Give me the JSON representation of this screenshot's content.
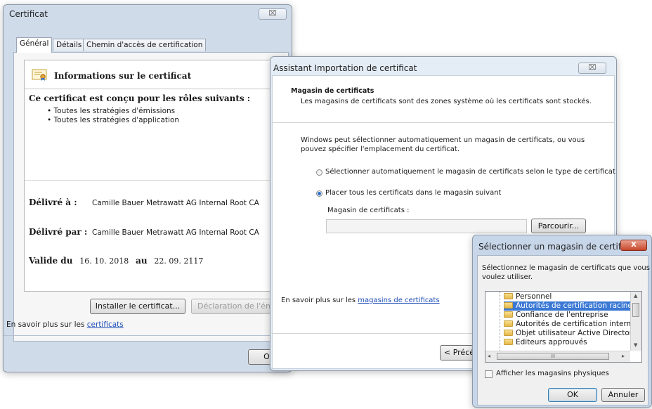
{
  "cert_window": {
    "title": "Certificat",
    "close_label": "⌧",
    "tabs": [
      {
        "label": "Général"
      },
      {
        "label": "Détails"
      },
      {
        "label": "Chemin d'accès de certification"
      }
    ],
    "info_header": "Informations sur le certificat",
    "roles_heading": "Ce certificat est conçu pour les rôles suivants :",
    "roles": [
      "• Toutes les stratégies d'émissions",
      "• Toutes les stratégies d'application"
    ],
    "issued_to_label": "Délivré à :",
    "issued_to_value": "Camille Bauer Metrawatt AG Internal Root CA",
    "issued_by_label": "Délivré par :",
    "issued_by_value": "Camille Bauer Metrawatt AG Internal Root CA",
    "valid_label": "Valide du",
    "valid_from": "16. 10. 2018",
    "valid_to_label": "au",
    "valid_to": "22. 09. 2117",
    "install_button": "Installer le certificat...",
    "issuer_statement_button": "Déclaration de l'émetteur",
    "learn_more_text": "En savoir plus sur les",
    "learn_more_link": "certificats",
    "ok_button": "OK"
  },
  "import_wizard": {
    "title": "Assistant Importation de certificat",
    "close_label": "⌧",
    "section_title": "Magasin de certificats",
    "section_desc": "Les magasins de certificats sont des zones système où les certificats sont stockés.",
    "intro_line1": "Windows peut sélectionner automatiquement un magasin de certificats, ou vous",
    "intro_line2": "pouvez spécifier l'emplacement du certificat.",
    "radio_auto": "Sélectionner automatiquement le magasin de certificats selon le type de certificat",
    "radio_manual": "Placer tous les certificats dans le magasin suivant",
    "store_label": "Magasin de certificats :",
    "store_value": "",
    "browse_button": "Parcourir...",
    "learn_more_text": "En savoir plus sur les",
    "learn_more_link": "magasins de certificats",
    "prev_button": "< Précédent"
  },
  "store_dialog": {
    "title": "Sélectionner un magasin de certificats",
    "close_label": "X",
    "prompt_line1": "Sélectionnez le magasin de certificats que vous",
    "prompt_line2": "voulez utiliser.",
    "stores": [
      {
        "label": "Personnel",
        "selected": false
      },
      {
        "label": "Autorités de certification racines de confiance",
        "selected": true
      },
      {
        "label": "Confiance de l'entreprise",
        "selected": false
      },
      {
        "label": "Autorités de certification intermédiaires",
        "selected": false
      },
      {
        "label": "Objet utilisateur Active Directory",
        "selected": false
      },
      {
        "label": "Éditeurs approuvés",
        "selected": false
      }
    ],
    "hscroll_mid": "III",
    "show_physical_label": "Afficher les magasins physiques",
    "show_physical_checked": false,
    "ok_button": "OK",
    "cancel_button": "Annuler"
  }
}
